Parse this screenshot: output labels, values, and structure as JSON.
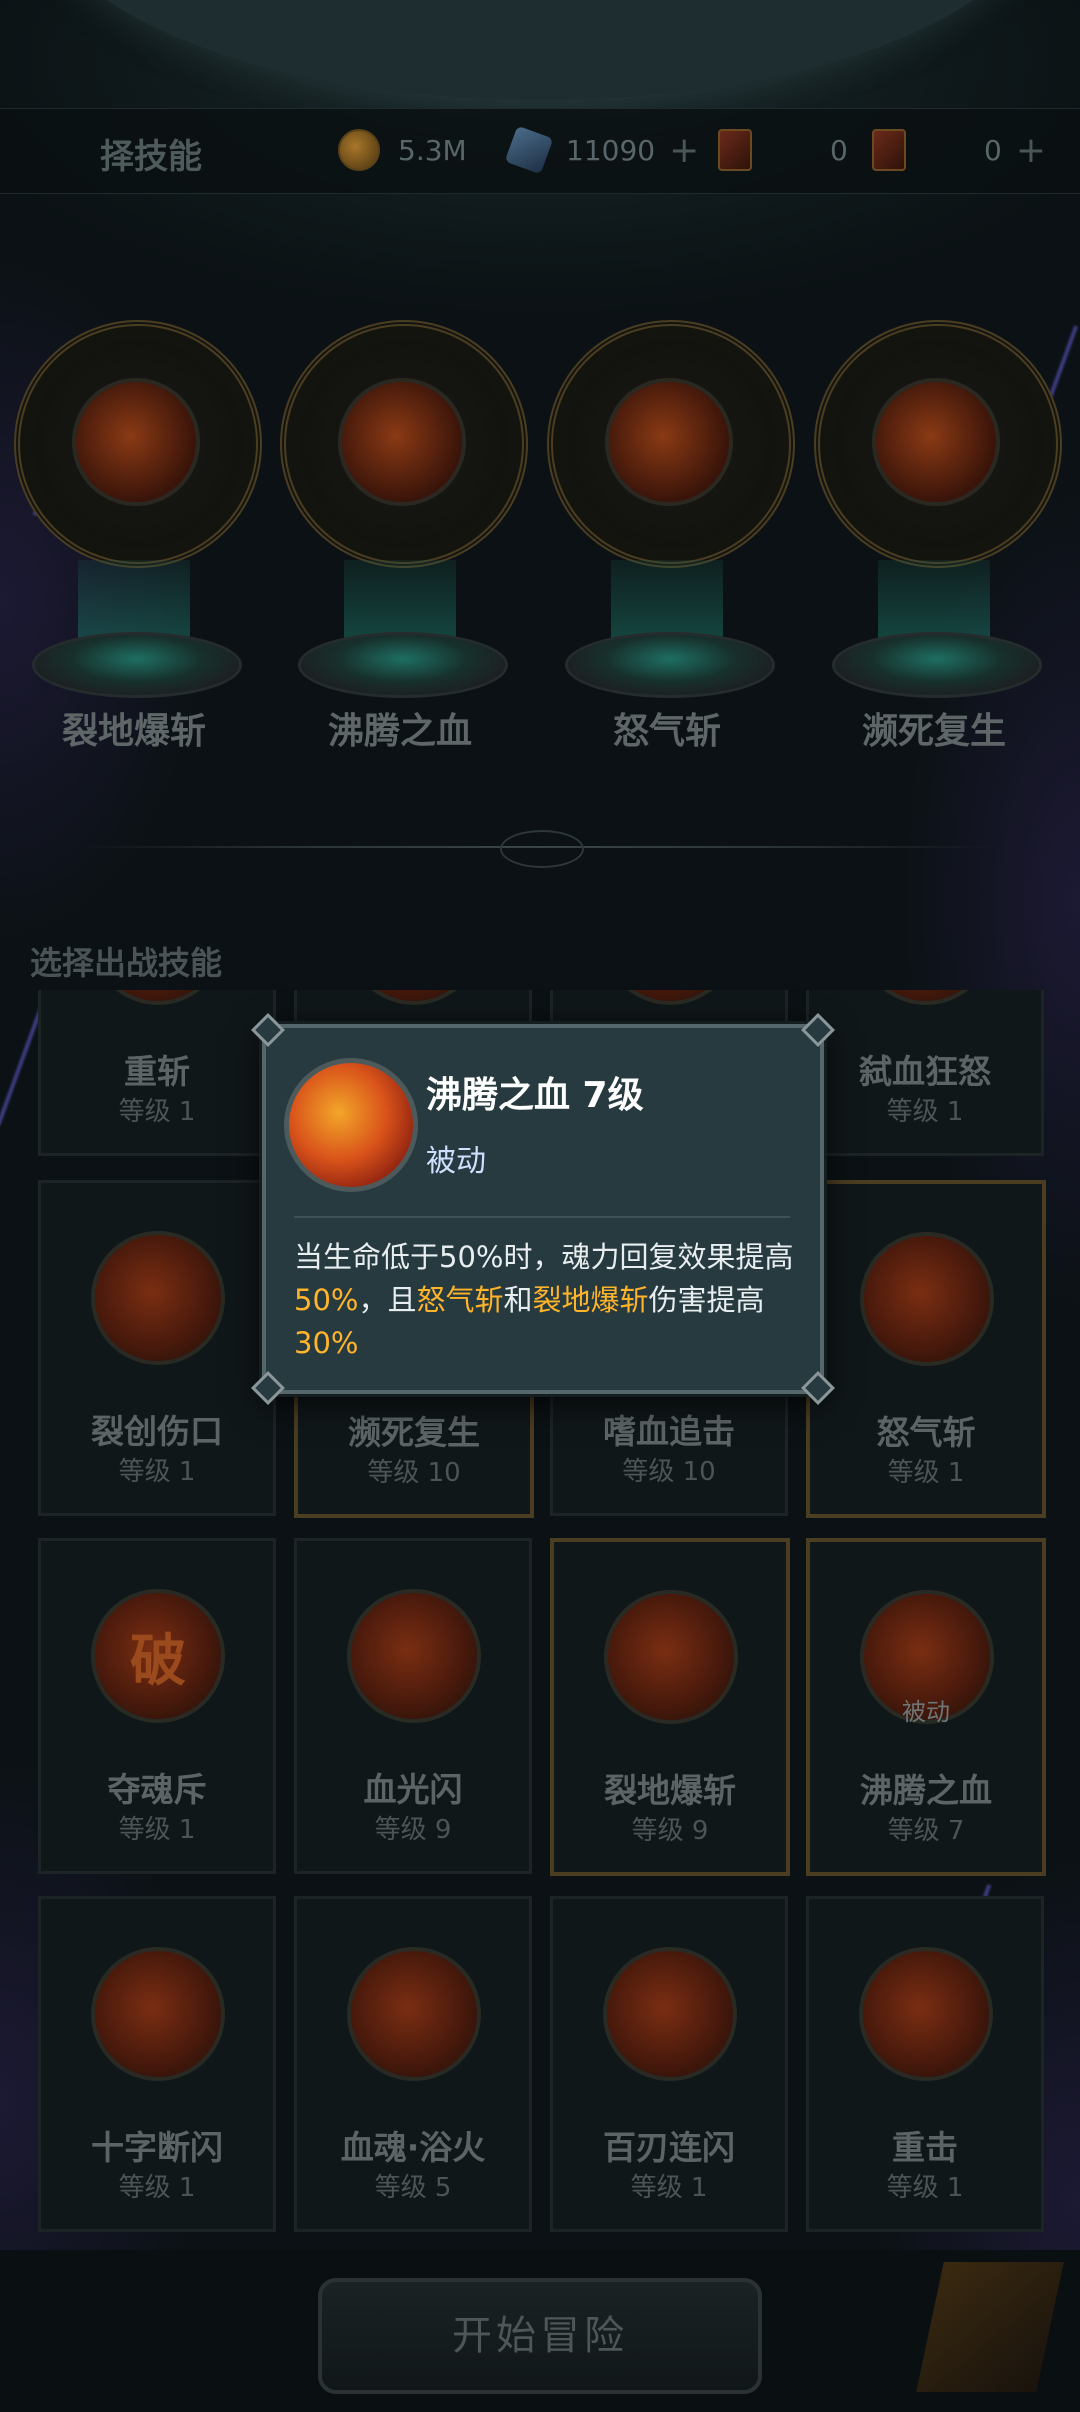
{
  "header": {
    "title": "择技能",
    "resources": [
      {
        "name": "gold",
        "icon": "coin-icon",
        "value": "5.3M"
      },
      {
        "name": "gem",
        "icon": "crystal-icon",
        "value": "11090"
      },
      {
        "name": "card_a",
        "icon": "card-icon",
        "value": "0"
      },
      {
        "name": "card_b",
        "icon": "scroll-icon",
        "value": "0"
      }
    ],
    "plus": "+"
  },
  "equipped": [
    {
      "label": "裂地爆斩"
    },
    {
      "label": "沸腾之血"
    },
    {
      "label": "怒气斩"
    },
    {
      "label": "濒死复生"
    }
  ],
  "select_label": "选择出战技能",
  "skills": [
    {
      "name": "重斩",
      "level": "等级 1",
      "selected": false
    },
    {
      "name": "",
      "level": "",
      "selected": false
    },
    {
      "name": "",
      "level": "",
      "selected": false
    },
    {
      "name": "弑血狂怒",
      "level": "等级 1",
      "selected": false
    },
    {
      "name": "裂创伤口",
      "level": "等级 1",
      "selected": false
    },
    {
      "name": "濒死复生",
      "level": "等级 10",
      "selected": true
    },
    {
      "name": "嗜血追击",
      "level": "等级 10",
      "selected": false
    },
    {
      "name": "怒气斩",
      "level": "等级 1",
      "selected": true
    },
    {
      "name": "夺魂斥",
      "level": "等级 1",
      "selected": false,
      "glyph": "破"
    },
    {
      "name": "血光闪",
      "level": "等级 9",
      "selected": false
    },
    {
      "name": "裂地爆斩",
      "level": "等级 9",
      "selected": true
    },
    {
      "name": "沸腾之血",
      "level": "等级 7",
      "selected": true,
      "tag": "被动"
    },
    {
      "name": "十字断闪",
      "level": "等级 1",
      "selected": false
    },
    {
      "name": "血魂·浴火",
      "level": "等级 5",
      "selected": false
    },
    {
      "name": "百刃连闪",
      "level": "等级 1",
      "selected": false
    },
    {
      "name": "重击",
      "level": "等级 1",
      "selected": false
    }
  ],
  "popup": {
    "title": "沸腾之血 7级",
    "type": "被动",
    "desc_parts": [
      {
        "text": "当生命低于50%时，魂力回复效果提高",
        "hl": false
      },
      {
        "text": "50%",
        "hl": true
      },
      {
        "text": "，且",
        "hl": false
      },
      {
        "text": "怒气斩",
        "hl": true
      },
      {
        "text": "和",
        "hl": false
      },
      {
        "text": "裂地爆斩",
        "hl": true
      },
      {
        "text": "伤害提高",
        "hl": false
      },
      {
        "text": "30%",
        "hl": true
      }
    ]
  },
  "start_button": "开始冒险",
  "colors": {
    "highlight": "#ffb42a",
    "popup_bg": "#263a3f"
  }
}
